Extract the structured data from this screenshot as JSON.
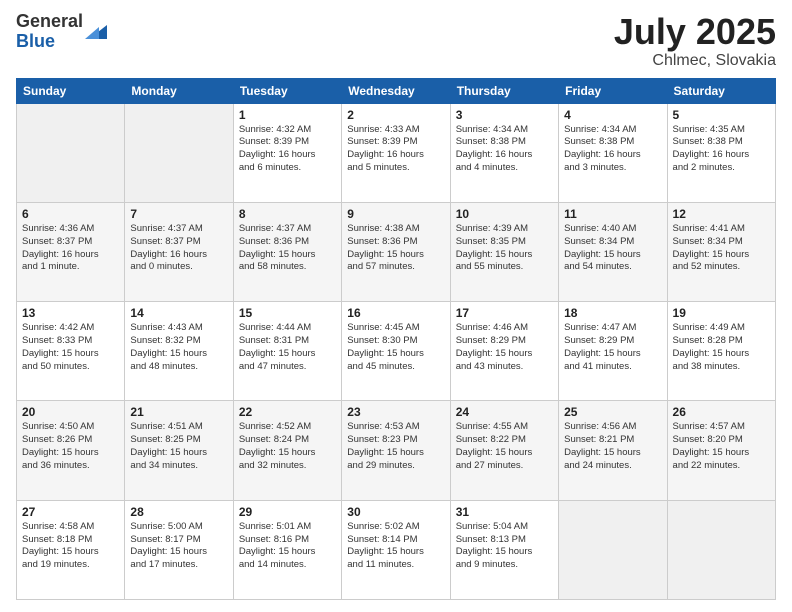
{
  "logo": {
    "general": "General",
    "blue": "Blue"
  },
  "title": {
    "month": "July 2025",
    "location": "Chlmec, Slovakia"
  },
  "header_days": [
    "Sunday",
    "Monday",
    "Tuesday",
    "Wednesday",
    "Thursday",
    "Friday",
    "Saturday"
  ],
  "weeks": [
    [
      {
        "day": "",
        "info": ""
      },
      {
        "day": "",
        "info": ""
      },
      {
        "day": "1",
        "info": "Sunrise: 4:32 AM\nSunset: 8:39 PM\nDaylight: 16 hours\nand 6 minutes."
      },
      {
        "day": "2",
        "info": "Sunrise: 4:33 AM\nSunset: 8:39 PM\nDaylight: 16 hours\nand 5 minutes."
      },
      {
        "day": "3",
        "info": "Sunrise: 4:34 AM\nSunset: 8:38 PM\nDaylight: 16 hours\nand 4 minutes."
      },
      {
        "day": "4",
        "info": "Sunrise: 4:34 AM\nSunset: 8:38 PM\nDaylight: 16 hours\nand 3 minutes."
      },
      {
        "day": "5",
        "info": "Sunrise: 4:35 AM\nSunset: 8:38 PM\nDaylight: 16 hours\nand 2 minutes."
      }
    ],
    [
      {
        "day": "6",
        "info": "Sunrise: 4:36 AM\nSunset: 8:37 PM\nDaylight: 16 hours\nand 1 minute."
      },
      {
        "day": "7",
        "info": "Sunrise: 4:37 AM\nSunset: 8:37 PM\nDaylight: 16 hours\nand 0 minutes."
      },
      {
        "day": "8",
        "info": "Sunrise: 4:37 AM\nSunset: 8:36 PM\nDaylight: 15 hours\nand 58 minutes."
      },
      {
        "day": "9",
        "info": "Sunrise: 4:38 AM\nSunset: 8:36 PM\nDaylight: 15 hours\nand 57 minutes."
      },
      {
        "day": "10",
        "info": "Sunrise: 4:39 AM\nSunset: 8:35 PM\nDaylight: 15 hours\nand 55 minutes."
      },
      {
        "day": "11",
        "info": "Sunrise: 4:40 AM\nSunset: 8:34 PM\nDaylight: 15 hours\nand 54 minutes."
      },
      {
        "day": "12",
        "info": "Sunrise: 4:41 AM\nSunset: 8:34 PM\nDaylight: 15 hours\nand 52 minutes."
      }
    ],
    [
      {
        "day": "13",
        "info": "Sunrise: 4:42 AM\nSunset: 8:33 PM\nDaylight: 15 hours\nand 50 minutes."
      },
      {
        "day": "14",
        "info": "Sunrise: 4:43 AM\nSunset: 8:32 PM\nDaylight: 15 hours\nand 48 minutes."
      },
      {
        "day": "15",
        "info": "Sunrise: 4:44 AM\nSunset: 8:31 PM\nDaylight: 15 hours\nand 47 minutes."
      },
      {
        "day": "16",
        "info": "Sunrise: 4:45 AM\nSunset: 8:30 PM\nDaylight: 15 hours\nand 45 minutes."
      },
      {
        "day": "17",
        "info": "Sunrise: 4:46 AM\nSunset: 8:29 PM\nDaylight: 15 hours\nand 43 minutes."
      },
      {
        "day": "18",
        "info": "Sunrise: 4:47 AM\nSunset: 8:29 PM\nDaylight: 15 hours\nand 41 minutes."
      },
      {
        "day": "19",
        "info": "Sunrise: 4:49 AM\nSunset: 8:28 PM\nDaylight: 15 hours\nand 38 minutes."
      }
    ],
    [
      {
        "day": "20",
        "info": "Sunrise: 4:50 AM\nSunset: 8:26 PM\nDaylight: 15 hours\nand 36 minutes."
      },
      {
        "day": "21",
        "info": "Sunrise: 4:51 AM\nSunset: 8:25 PM\nDaylight: 15 hours\nand 34 minutes."
      },
      {
        "day": "22",
        "info": "Sunrise: 4:52 AM\nSunset: 8:24 PM\nDaylight: 15 hours\nand 32 minutes."
      },
      {
        "day": "23",
        "info": "Sunrise: 4:53 AM\nSunset: 8:23 PM\nDaylight: 15 hours\nand 29 minutes."
      },
      {
        "day": "24",
        "info": "Sunrise: 4:55 AM\nSunset: 8:22 PM\nDaylight: 15 hours\nand 27 minutes."
      },
      {
        "day": "25",
        "info": "Sunrise: 4:56 AM\nSunset: 8:21 PM\nDaylight: 15 hours\nand 24 minutes."
      },
      {
        "day": "26",
        "info": "Sunrise: 4:57 AM\nSunset: 8:20 PM\nDaylight: 15 hours\nand 22 minutes."
      }
    ],
    [
      {
        "day": "27",
        "info": "Sunrise: 4:58 AM\nSunset: 8:18 PM\nDaylight: 15 hours\nand 19 minutes."
      },
      {
        "day": "28",
        "info": "Sunrise: 5:00 AM\nSunset: 8:17 PM\nDaylight: 15 hours\nand 17 minutes."
      },
      {
        "day": "29",
        "info": "Sunrise: 5:01 AM\nSunset: 8:16 PM\nDaylight: 15 hours\nand 14 minutes."
      },
      {
        "day": "30",
        "info": "Sunrise: 5:02 AM\nSunset: 8:14 PM\nDaylight: 15 hours\nand 11 minutes."
      },
      {
        "day": "31",
        "info": "Sunrise: 5:04 AM\nSunset: 8:13 PM\nDaylight: 15 hours\nand 9 minutes."
      },
      {
        "day": "",
        "info": ""
      },
      {
        "day": "",
        "info": ""
      }
    ]
  ]
}
